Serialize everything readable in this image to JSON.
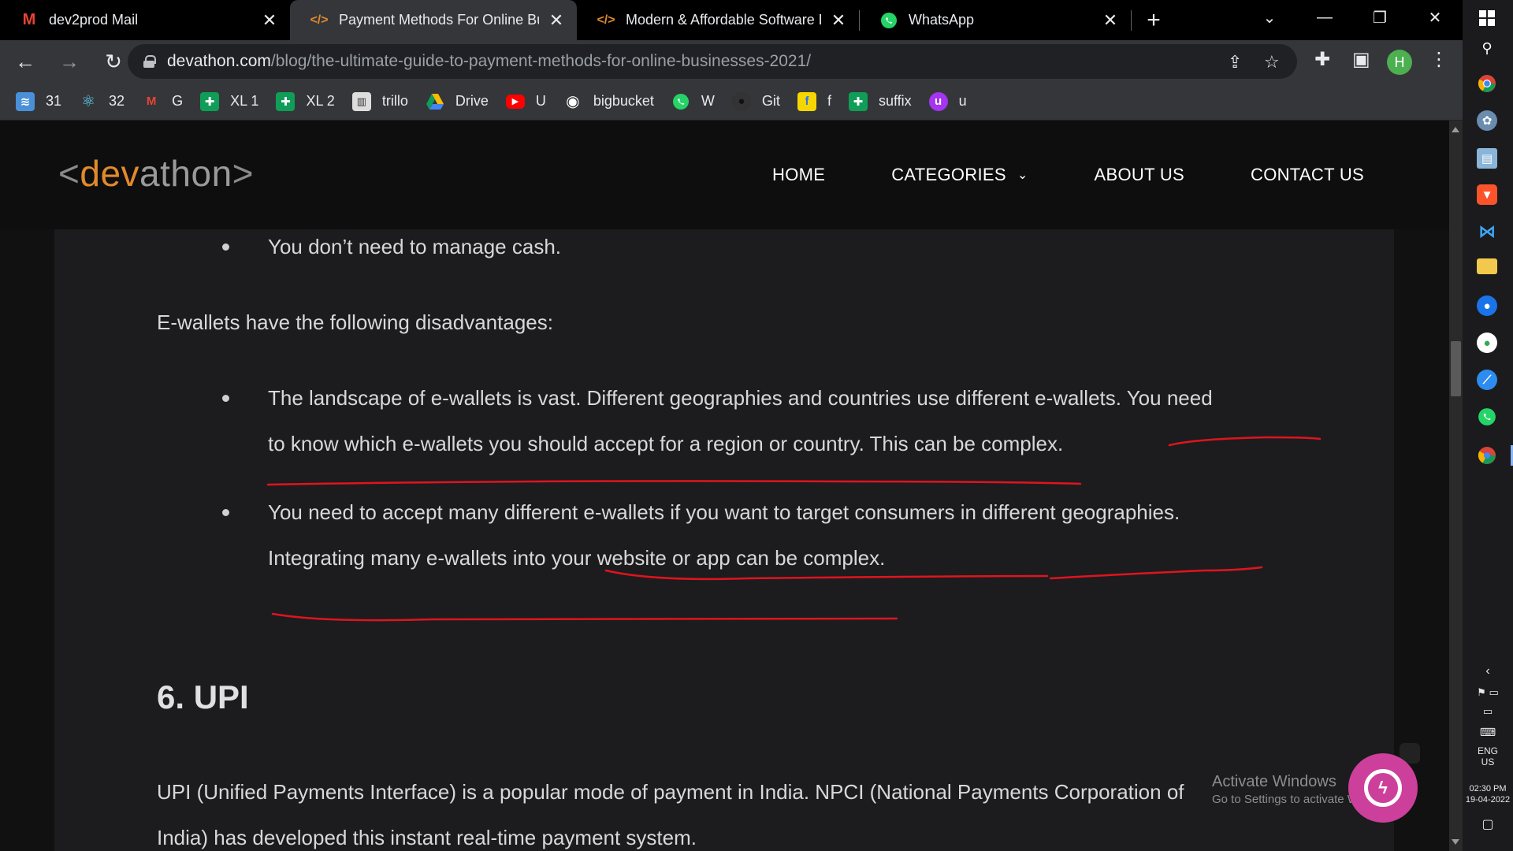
{
  "browser": {
    "tabs": [
      {
        "title": "dev2prod Mail",
        "icon": "gmail-icon",
        "active": false
      },
      {
        "title": "Payment Methods For Online Bu",
        "icon": "code-icon",
        "active": true
      },
      {
        "title": "Modern & Affordable Software D",
        "icon": "code-icon",
        "active": false
      },
      {
        "title": "WhatsApp",
        "icon": "whatsapp-icon",
        "active": false
      }
    ],
    "new_tab": "+",
    "url_host": "devathon.com",
    "url_path": "/blog/the-ultimate-guide-to-payment-methods-for-online-businesses-2021/",
    "profile_initial": "H",
    "bookmarks": [
      {
        "label": "31",
        "icon": "stack-icon",
        "color": "#4a90d9"
      },
      {
        "label": "32",
        "icon": "react-icon",
        "color": "#61dafb"
      },
      {
        "label": "G",
        "icon": "gmail-icon",
        "color": "#ea4335"
      },
      {
        "label": "XL 1",
        "icon": "sheets-icon",
        "color": "#0f9d58"
      },
      {
        "label": "XL 2",
        "icon": "sheets-icon",
        "color": "#0f9d58"
      },
      {
        "label": "trillo",
        "icon": "trello-icon",
        "color": "#dddddd"
      },
      {
        "label": "Drive",
        "icon": "drive-icon",
        "color": "#fbbc04"
      },
      {
        "label": "U",
        "icon": "youtube-icon",
        "color": "#ff0000"
      },
      {
        "label": "bigbucket",
        "icon": "globe-icon",
        "color": "#ffffff"
      },
      {
        "label": "W",
        "icon": "whatsapp-icon",
        "color": "#25d366"
      },
      {
        "label": "Git",
        "icon": "github-icon",
        "color": "#333333"
      },
      {
        "label": "f",
        "icon": "flipkart-icon",
        "color": "#f7d600"
      },
      {
        "label": "suffix",
        "icon": "sheets-icon",
        "color": "#0f9d58"
      },
      {
        "label": "u",
        "icon": "udemy-icon",
        "color": "#a435f0"
      }
    ]
  },
  "site": {
    "logo_open": "<",
    "logo_dev": "dev",
    "logo_athon": "athon",
    "logo_close": ">",
    "nav": [
      "HOME",
      "CATEGORIES",
      "ABOUT US",
      "CONTACT US"
    ]
  },
  "article": {
    "bullet_top": "You don’t need to manage cash.",
    "disadvantages_intro": "E-wallets have the following disadvantages:",
    "bullet1_line1": "The landscape of e-wallets is vast. Different geographies and countries use different e-wallets. You need",
    "bullet1_line2": "to know which e-wallets you should accept for a region or country. This can be complex.",
    "bullet2_line1": "You need to accept many different e-wallets if you want to target consumers in different geographies.",
    "bullet2_line2": "Integrating many e-wallets into your website or app can be complex.",
    "heading_upi": "6. UPI",
    "upi_line1": "UPI (Unified Payments Interface) is a popular mode of payment in India. NPCI (National Payments Corporation of",
    "upi_line2": "India) has developed this instant real-time payment system.",
    "annotation_color": "#e0141e"
  },
  "overlay": {
    "watermark_line1": "Activate Windows",
    "watermark_line2": "Go to Settings to activate Windows."
  },
  "taskbar": {
    "language": "ENG",
    "region": "US",
    "time": "02:30 PM",
    "date": "19-04-2022",
    "pinned": [
      "windows-start-icon",
      "search-icon",
      "chrome-icon",
      "app-icon",
      "notes-icon",
      "brave-icon",
      "vscode-icon",
      "file-explorer-icon",
      "maps-icon",
      "app-icon",
      "compass-icon",
      "whatsapp-icon",
      "chrome-profile-icon"
    ]
  }
}
